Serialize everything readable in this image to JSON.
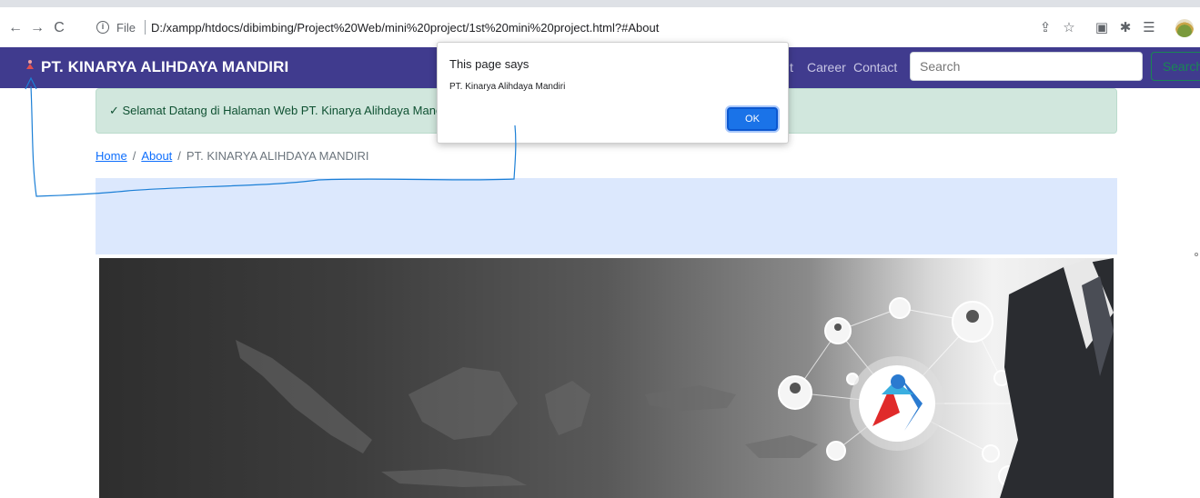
{
  "browser": {
    "file_label": "File",
    "url": "D:/xampp/htdocs/dibimbing/Project%20Web/mini%20project/1st%20mini%20project.html?#About",
    "icons": [
      "back-arrow-icon",
      "forward-arrow-icon",
      "reload-icon",
      "info-icon",
      "share-icon",
      "star-icon",
      "extension-icon",
      "puzzle-icon",
      "reading-list-icon",
      "profile-avatar"
    ]
  },
  "navbar": {
    "brand": "PT. KINARYA ALIHDAYA MANDIRI",
    "links": {
      "partial": "t",
      "career": "Career",
      "contact": "Contact"
    },
    "search_placeholder": "Search",
    "search_button": "Search",
    "bg_color": "#403b8e"
  },
  "alert": {
    "text": "✓ Selamat Datang di Halaman Web PT. Kinarya Alihdaya Mandiri"
  },
  "breadcrumb": {
    "home": "Home",
    "about": "About",
    "current": "PT. KINARYA ALIHDAYA MANDIRI"
  },
  "dialog": {
    "title": "This page says",
    "message": "PT. Kinarya Alihdaya Mandiri",
    "ok_label": "OK"
  }
}
